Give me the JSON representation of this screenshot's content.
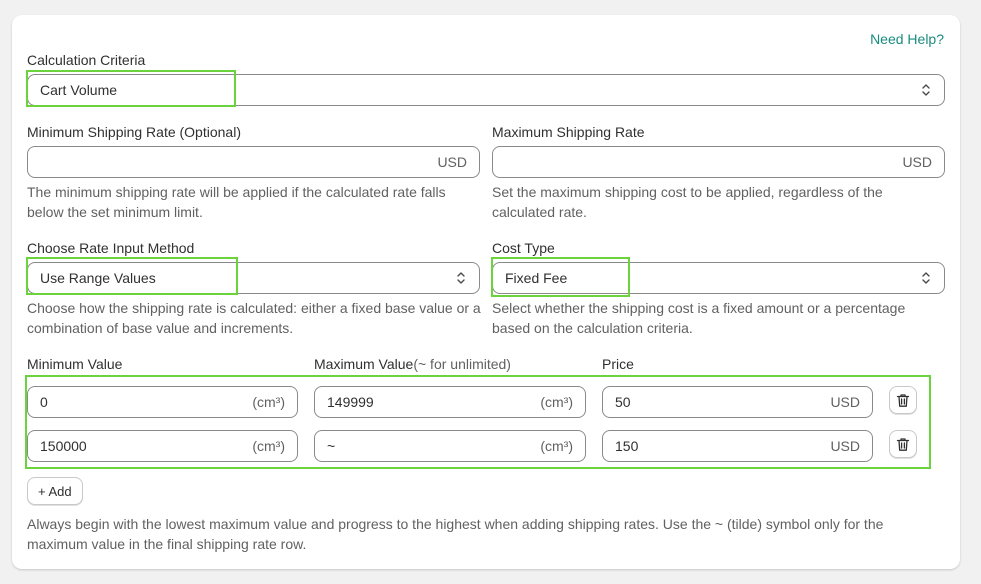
{
  "help_link": "Need Help?",
  "calculation_criteria": {
    "label": "Calculation Criteria",
    "value": "Cart Volume"
  },
  "min_shipping_rate": {
    "label": "Minimum Shipping Rate (Optional)",
    "value": "",
    "suffix": "USD",
    "help": "The minimum shipping rate will be applied if the calculated rate falls below the set minimum limit."
  },
  "max_shipping_rate": {
    "label": "Maximum Shipping Rate",
    "value": "",
    "suffix": "USD",
    "help": "Set the maximum shipping cost to be applied, regardless of the calculated rate."
  },
  "rate_input_method": {
    "label": "Choose Rate Input Method",
    "value": "Use Range Values",
    "help": "Choose how the shipping rate is calculated: either a fixed base value or a combination of base value and increments."
  },
  "cost_type": {
    "label": "Cost Type",
    "value": "Fixed Fee",
    "help": "Select whether the shipping cost is a fixed amount or a percentage based on the calculation criteria."
  },
  "ranges": {
    "headers": {
      "min": "Minimum Value",
      "max": "Maximum Value",
      "max_note": "(~ for unlimited)",
      "price": "Price"
    },
    "unit_suffix": "(cm³)",
    "price_suffix": "USD",
    "rows": [
      {
        "min": "0",
        "max": "149999",
        "price": "50"
      },
      {
        "min": "150000",
        "max": "~",
        "price": "150"
      }
    ]
  },
  "add_button": "+ Add",
  "footer_note": "Always begin with the lowest maximum value and progress to the highest when adding shipping rates. Use the ~ (tilde) symbol only for the maximum value in the final shipping rate row.",
  "colors": {
    "highlight": "#6bd33b",
    "link": "#1a8c7f"
  },
  "icons": {
    "select_chevron": "chevron-up-down-icon",
    "delete": "trash-icon"
  }
}
